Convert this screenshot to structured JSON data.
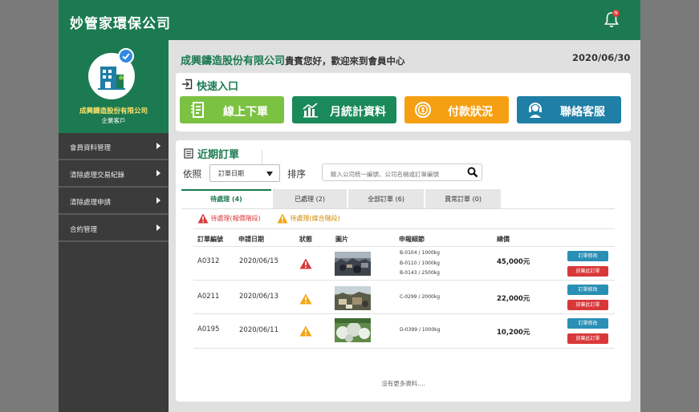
{
  "app": {
    "title": "妙管家環保公司",
    "notification_count": "N"
  },
  "profile": {
    "company": "成興鑄造股份有限公司",
    "type": "企業客戶"
  },
  "sidebar": {
    "items": [
      {
        "label": "會員資料管理"
      },
      {
        "label": "清除處理交易紀錄"
      },
      {
        "label": "清除處理申請"
      },
      {
        "label": "合約管理"
      }
    ]
  },
  "header": {
    "company": "成興鑄造股份有限公司",
    "greeting": "貴賓您好，歡迎來到會員中心",
    "date": "2020/06/30"
  },
  "quick": {
    "title": "快速入口",
    "buttons": [
      {
        "label": "線上下單",
        "color": "#7cc242",
        "icon": "order-form-icon"
      },
      {
        "label": "月統計資料",
        "color": "#1b8a5a",
        "icon": "bar-chart-icon"
      },
      {
        "label": "付款狀況",
        "color": "#f5a012",
        "icon": "coin-icon"
      },
      {
        "label": "聯絡客服",
        "color": "#1f7fa6",
        "icon": "headset-icon"
      }
    ]
  },
  "orders": {
    "title": "近期訂單",
    "sort_by_label": "依照",
    "sort_field": "訂單日期",
    "order_label": "排序",
    "search_placeholder": "輸入公司統一編號、公司名稱或訂單編號",
    "tabs": [
      {
        "label": "待處理 (4)",
        "active": true
      },
      {
        "label": "已處理 (2)",
        "active": false
      },
      {
        "label": "全部訂單 (6)",
        "active": false
      },
      {
        "label": "異常訂單 (0)",
        "active": false
      }
    ],
    "legend": [
      {
        "label": "待處理(報價階段)",
        "color": "#d9383a"
      },
      {
        "label": "待處理(媒合階段)",
        "color": "#f2a516"
      }
    ],
    "columns": [
      "訂單編號",
      "申請日期",
      "狀態",
      "圖片",
      "申報細節",
      "總價"
    ],
    "rows": [
      {
        "id": "A0312",
        "date": "2020/06/15",
        "status": "quote",
        "details": [
          "B-0104 / 1000kg",
          "B-0110 / 1000kg",
          "B-0143 / 2500kg"
        ],
        "total": "45,000元"
      },
      {
        "id": "A0211",
        "date": "2020/06/13",
        "status": "match",
        "details": [
          "C-0299 / 2000kg"
        ],
        "total": "22,000元"
      },
      {
        "id": "A0195",
        "date": "2020/06/11",
        "status": "match",
        "details": [
          "D-0399 / 1000kg"
        ],
        "total": "10,200元"
      }
    ],
    "edit_label": "訂單修改",
    "cancel_label": "放棄此訂單",
    "no_more": "沒有更多資料...."
  }
}
